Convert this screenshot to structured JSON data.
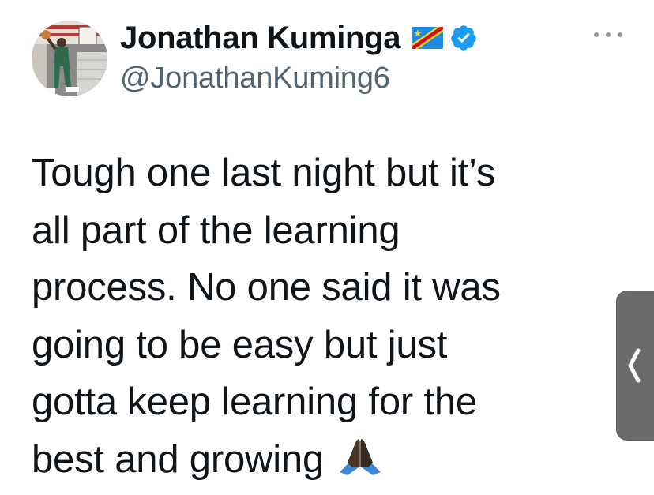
{
  "tweet": {
    "author": {
      "display_name": "Jonathan Kuminga",
      "handle": "@JonathanKuming6",
      "flag_icon": "drc-flag-icon",
      "verified_icon": "verified-badge-icon",
      "verified_color": "#1d9bf0"
    },
    "text_lines": [
      "Tough one last night but it’s",
      "all part of the learning",
      "process. No one said it was",
      "going to be easy but just",
      "gotta keep learning for the",
      "best and growing"
    ],
    "emoji": "praying-hands-icon"
  },
  "ui": {
    "more_icon": "more-options-icon",
    "side_tab_icon": "chevron-left-icon"
  }
}
